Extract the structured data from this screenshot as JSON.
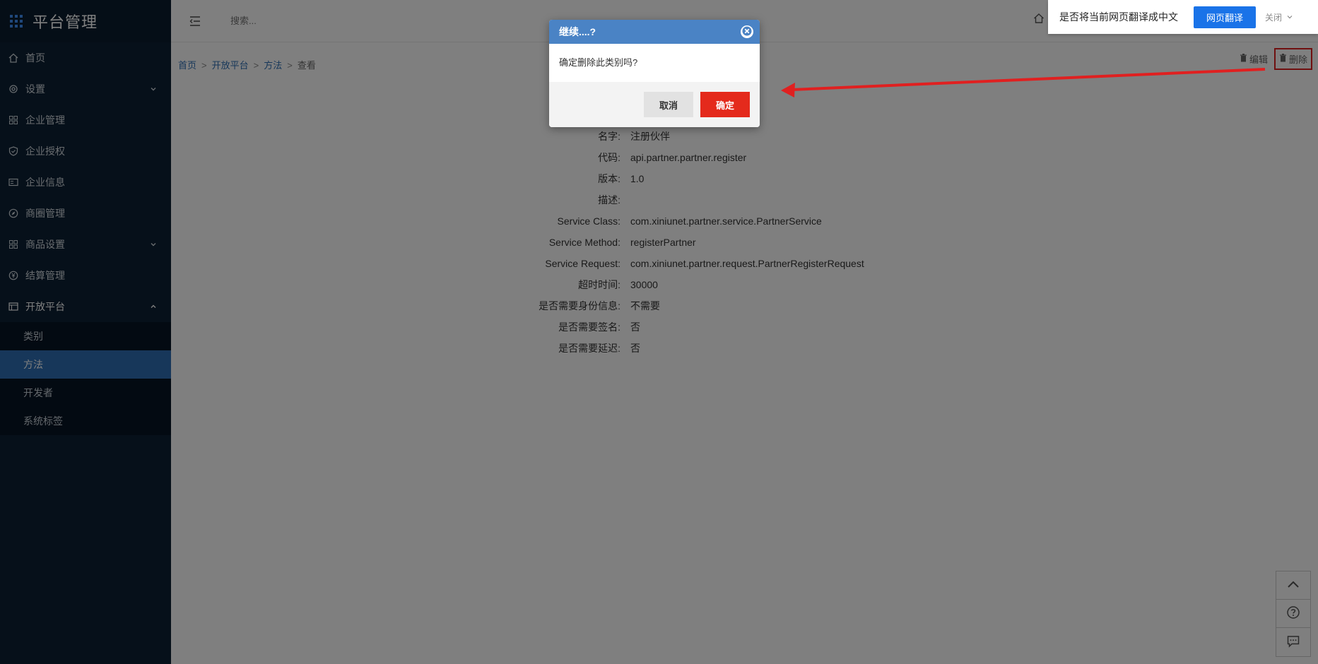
{
  "sidebar": {
    "title": "平台管理",
    "items": [
      {
        "label": "首页",
        "icon": "home-icon",
        "chevron": ""
      },
      {
        "label": "设置",
        "icon": "gear-icon",
        "chevron": "down"
      },
      {
        "label": "企业管理",
        "icon": "apps-icon",
        "chevron": ""
      },
      {
        "label": "企业授权",
        "icon": "shield-check-icon",
        "chevron": ""
      },
      {
        "label": "企业信息",
        "icon": "id-card-icon",
        "chevron": ""
      },
      {
        "label": "商圈管理",
        "icon": "compass-icon",
        "chevron": ""
      },
      {
        "label": "商品设置",
        "icon": "grid-icon",
        "chevron": "down"
      },
      {
        "label": "结算管理",
        "icon": "yen-icon",
        "chevron": ""
      },
      {
        "label": "开放平台",
        "icon": "table-icon",
        "chevron": "up"
      }
    ],
    "sub_items": [
      {
        "label": "类别",
        "active": false
      },
      {
        "label": "方法",
        "active": true
      },
      {
        "label": "开发者",
        "active": false
      },
      {
        "label": "系统标签",
        "active": false
      }
    ]
  },
  "topbar": {
    "search_placeholder": "搜索..."
  },
  "breadcrumb": {
    "home": "首页",
    "platform": "开放平台",
    "method": "方法",
    "current": "查看",
    "sep": ">"
  },
  "actions": {
    "edit": "编辑",
    "delete": "删除"
  },
  "detail": [
    {
      "k": "名字:",
      "v": "注册伙伴"
    },
    {
      "k": "代码:",
      "v": "api.partner.partner.register"
    },
    {
      "k": "版本:",
      "v": "1.0"
    },
    {
      "k": "描述:",
      "v": ""
    },
    {
      "k": "Service Class:",
      "v": "com.xiniunet.partner.service.PartnerService"
    },
    {
      "k": "Service Method:",
      "v": "registerPartner"
    },
    {
      "k": "Service Request:",
      "v": "com.xiniunet.partner.request.PartnerRegisterRequest"
    },
    {
      "k": "超时时间:",
      "v": "30000"
    },
    {
      "k": "是否需要身份信息:",
      "v": "不需要"
    },
    {
      "k": "是否需要签名:",
      "v": "否"
    },
    {
      "k": "是否需要延迟:",
      "v": "否"
    }
  ],
  "translate": {
    "prompt": "是否将当前网页翻译成中文",
    "button": "网页翻译",
    "close": "关闭"
  },
  "modal": {
    "title": "继续....?",
    "message": "确定删除此类别吗?",
    "cancel": "取消",
    "confirm": "确定"
  },
  "colors": {
    "sidebar_bg": "#0c2135",
    "active_item": "#2f6fb5",
    "modal_header": "#4a83c5",
    "confirm_button": "#e42a1c",
    "annotation": "#e02020"
  }
}
